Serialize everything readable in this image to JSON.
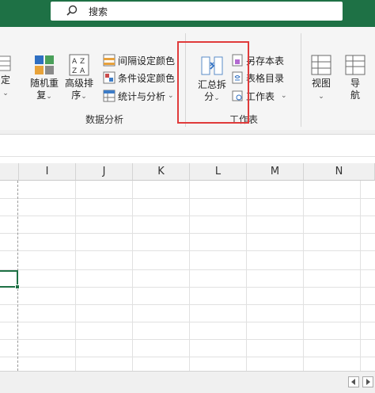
{
  "search": {
    "label": "搜索"
  },
  "ribbon": {
    "partial_left_label": "定",
    "random_repeat": {
      "line1": "随机重",
      "line2": "复"
    },
    "advanced_sort": {
      "line1": "高级排",
      "line2": "序"
    },
    "interval_color": "间隔设定颜色",
    "condition_color": "条件设定颜色",
    "stats_analysis": "统计与分析",
    "group_data_analysis": "数据分析",
    "summary_split": {
      "line1": "汇总拆",
      "line2": "分"
    },
    "save_sheet_as": "另存本表",
    "table_catalog": "表格目录",
    "worksheet": "工作表",
    "group_worksheet": "工作表",
    "view": "视图",
    "navigate": {
      "line1": "导",
      "line2": "航"
    },
    "chevron": "⌄"
  },
  "sheet": {
    "columns": [
      "I",
      "J",
      "K",
      "L",
      "M",
      "N"
    ]
  },
  "colors": {
    "accent": "#1e7145",
    "highlight": "#e03b3b"
  }
}
